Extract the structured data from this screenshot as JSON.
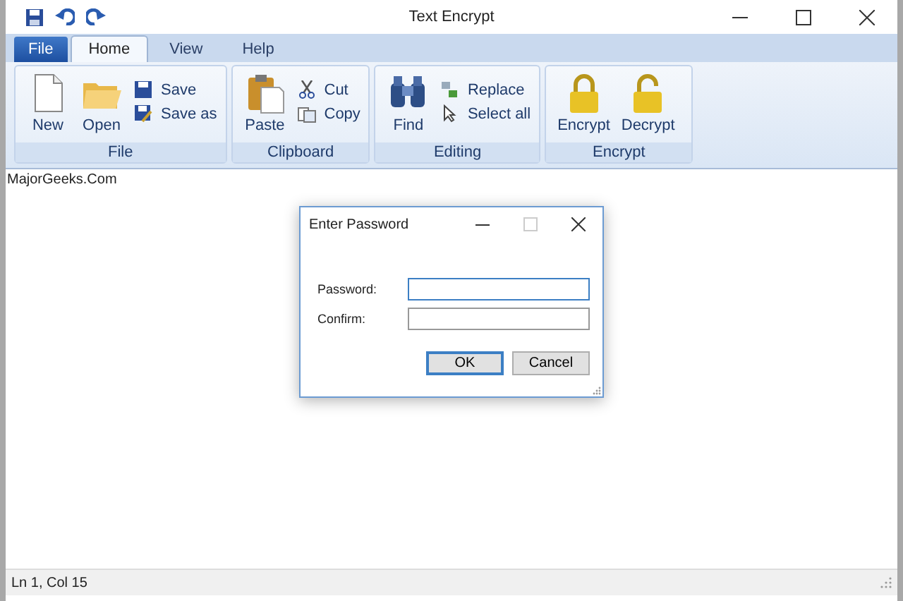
{
  "window": {
    "title": "Text Encrypt"
  },
  "tabs": [
    {
      "label": "File",
      "kind": "menu",
      "selected": false
    },
    {
      "label": "Home",
      "kind": "tab",
      "selected": true
    },
    {
      "label": "View",
      "kind": "tab",
      "selected": false
    },
    {
      "label": "Help",
      "kind": "tab",
      "selected": false
    }
  ],
  "ribbon_groups": [
    {
      "label": "File",
      "buttons": [
        {
          "label": "New",
          "kind": "large"
        },
        {
          "label": "Open",
          "kind": "large"
        },
        {
          "label": "Save",
          "kind": "small"
        },
        {
          "label": "Save as",
          "kind": "small"
        }
      ]
    },
    {
      "label": "Clipboard",
      "buttons": [
        {
          "label": "Paste",
          "kind": "large"
        },
        {
          "label": "Cut",
          "kind": "small"
        },
        {
          "label": "Copy",
          "kind": "small"
        }
      ]
    },
    {
      "label": "Editing",
      "buttons": [
        {
          "label": "Find",
          "kind": "large"
        },
        {
          "label": "Replace",
          "kind": "small"
        },
        {
          "label": "Select all",
          "kind": "small"
        }
      ]
    },
    {
      "label": "Encrypt",
      "buttons": [
        {
          "label": "Encrypt",
          "kind": "large"
        },
        {
          "label": "Decrypt",
          "kind": "large"
        }
      ]
    }
  ],
  "editor": {
    "text": "MajorGeeks.Com"
  },
  "dialog": {
    "title": "Enter Password",
    "fields": [
      {
        "label": "Password:",
        "focused": true
      },
      {
        "label": "Confirm:",
        "focused": false
      }
    ],
    "buttons": [
      {
        "label": "OK",
        "default": true
      },
      {
        "label": "Cancel",
        "default": false
      }
    ]
  },
  "status_bar": {
    "text": "Ln 1, Col 15"
  }
}
